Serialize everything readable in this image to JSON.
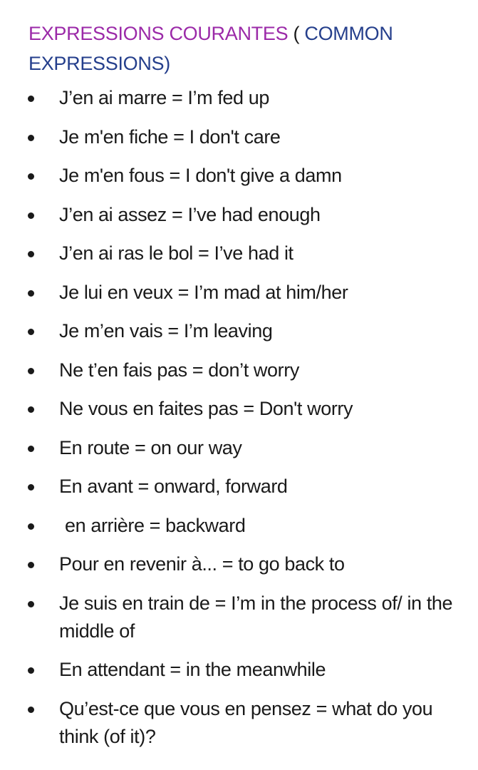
{
  "title": {
    "french": "EXPRESSIONS COURANTES",
    "separator": " ( ",
    "english": "COMMON EXPRESSIONS)"
  },
  "items": [
    "J’en ai marre = I’m fed up",
    "Je m'en fiche = I don't care",
    "Je m'en fous = I don't give a damn",
    "J’en ai assez = I’ve had enough",
    "J’en ai ras le bol = I’ve had it",
    "Je lui en veux = I’m mad at him/her",
    "Je m’en vais = I’m leaving",
    "Ne t’en fais pas = don’t worry",
    "Ne vous en faites pas = Don't worry",
    "En route = on our way",
    "En avant  = onward, forward",
    "en arrière =  backward",
    "Pour en revenir à... = to go back to",
    "Je suis en train de = I’m in the process of/ in the middle of",
    "En attendant = in the meanwhile",
    "Qu’est-ce que vous en pensez = what do you think (of it)?"
  ]
}
